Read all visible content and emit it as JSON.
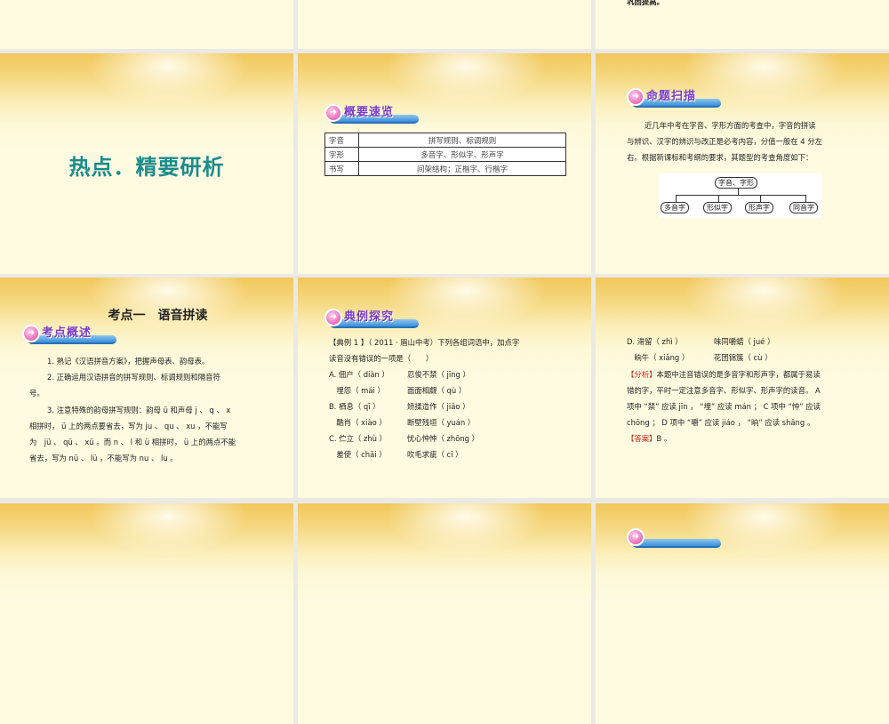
{
  "slides": [
    {
      "id": "r1c3",
      "partial_text": "巩固提高。"
    },
    {
      "id": "title",
      "title": "热点．精要研析"
    },
    {
      "id": "overview",
      "header": "概要速览",
      "table": [
        [
          "字音",
          "拼写规则、标调规则"
        ],
        [
          "字形",
          "多音字、形似字、形声字"
        ],
        [
          "书写",
          "间架结构；正楷字、行楷字"
        ]
      ]
    },
    {
      "id": "scan",
      "header": "命题扫描",
      "lines": [
        "近几年中考在字音、字形方面的考查中，字音的拼读",
        "与辨识、汉字的辨识与改正是必考内容，分值一般在 4 分左",
        "右。根据新课标和考纲的要求，其题型的考查角度如下："
      ],
      "diagram": {
        "root": "字音、字形",
        "children": [
          "多音字",
          "形似字",
          "形声字",
          "同音字"
        ]
      }
    },
    {
      "id": "kaodian",
      "title": "考点一　语音拼读",
      "header": "考点概述",
      "lines": [
        "1. 熟记《汉语拼音方案》，把握声母表、韵母表。",
        "2. 正确运用汉语拼音的拼写规则、标调规则和隔音符",
        "号。",
        "3. 注意特殊的韵母拼写规则：韵母 ü 和声母 j 、 q 、 x",
        "相拼时， ü 上的两点要省去，写为 ju 、 qu 、 xu ，不能写",
        "为　jü 、 qü 、 xü 。而 n 、 l 和 ü 相拼时， ü 上的两点不能",
        "省去，写为 nü 、 lü ，不能写为 nu 、 lu 。"
      ]
    },
    {
      "id": "example",
      "header": "典例探究",
      "lines": [
        "【典例 1 】（ 2011 · 眉山中考）下列各组词语中，加点字",
        "读音没有错误的一项是（　　）"
      ],
      "options": [
        [
          "A. 佃户（ diàn ）",
          "忍俊不禁（ jīng ）"
        ],
        [
          "　埋怨（ mái ）",
          "面面相觑（ qù ）"
        ],
        [
          "B. 栖息（ qī ）",
          "矫揉造作（ jiǎo ）"
        ],
        [
          "　酷肖（ xiào ）",
          "断壁残垣（ yuán ）"
        ],
        [
          "C. 伫立（ zhù ）",
          "忧心忡忡（ zhōng ）"
        ],
        [
          "　差使（ chāi ）",
          "吹毛求疵（ cī ）"
        ]
      ]
    },
    {
      "id": "analysis",
      "options": [
        [
          "D. 滞留（ zhì ）",
          "味同嚼蜡（ jué ）"
        ],
        [
          "　晌午（ xiǎng ）",
          "花团锦簇（ cù ）"
        ]
      ],
      "analysis_label": "【分析】",
      "analysis_lines": [
        "本题中注音错误的是多音字和形声字，都属于易读",
        "错的字，平时一定注意多音字、形似字、形声字的读音。 A",
        "项中 “禁” 应读 jīn ， “埋” 应读 mán ； C 项中 “忡” 应读",
        "chōng ； D 项中 “嚼” 应读 jiáo ， “晌” 应读 shǎng 。"
      ],
      "answer_label": "【答案】",
      "answer": "B 。"
    }
  ]
}
